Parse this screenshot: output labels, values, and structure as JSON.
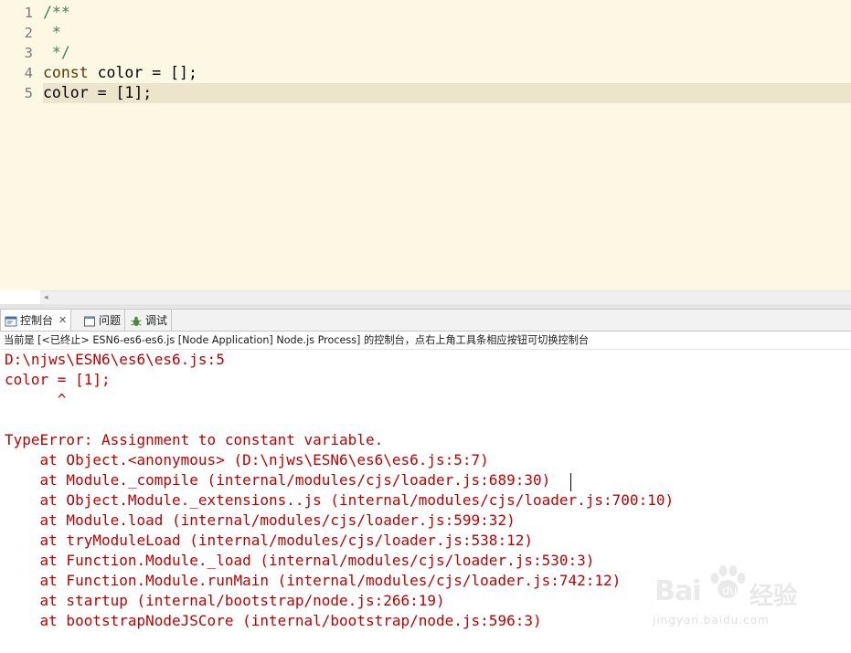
{
  "editor": {
    "line_numbers": [
      "1",
      "2",
      "3",
      "4",
      "5"
    ],
    "lines": [
      {
        "parts": [
          {
            "t": "/**",
            "c": "cm"
          }
        ]
      },
      {
        "parts": [
          {
            "t": " *",
            "c": "cm"
          }
        ]
      },
      {
        "parts": [
          {
            "t": " */",
            "c": "cm"
          }
        ]
      },
      {
        "parts": [
          {
            "t": "const",
            "c": "kw"
          },
          {
            "t": " color = [];",
            "c": ""
          }
        ]
      },
      {
        "parts": [
          {
            "t": "color = [1];",
            "c": ""
          }
        ],
        "current": true
      }
    ],
    "scroll_left_glyph": "◂"
  },
  "tabs": [
    {
      "label": "控制台",
      "icon": "console-icon",
      "close": "✕",
      "active": true
    },
    {
      "label": "问题",
      "icon": "problems-icon",
      "active": false
    },
    {
      "label": "调试",
      "icon": "debug-icon",
      "active": false
    }
  ],
  "console": {
    "description": "当前是 [<已终止> ESN6-es6-es6.js [Node Application] Node.js Process] 的控制台，点右上角工具条相应按钮可切换控制台",
    "output": [
      "D:\\njws\\ESN6\\es6\\es6.js:5",
      "color = [1];",
      "      ^",
      "",
      "TypeError: Assignment to constant variable.",
      "    at Object.<anonymous> (D:\\njws\\ESN6\\es6\\es6.js:5:7)",
      "    at Module._compile (internal/modules/cjs/loader.js:689:30)",
      "    at Object.Module._extensions..js (internal/modules/cjs/loader.js:700:10)",
      "    at Module.load (internal/modules/cjs/loader.js:599:32)",
      "    at tryModuleLoad (internal/modules/cjs/loader.js:538:12)",
      "    at Function.Module._load (internal/modules/cjs/loader.js:530:3)",
      "    at Function.Module.runMain (internal/modules/cjs/loader.js:742:12)",
      "    at startup (internal/bootstrap/node.js:266:19)",
      "    at bootstrapNodeJSCore (internal/bootstrap/node.js:596:3)"
    ],
    "error_color": "#c00000"
  },
  "watermark": {
    "brand_left": "Bai",
    "brand_right": "经验",
    "url": "jingyan.baidu.com"
  }
}
